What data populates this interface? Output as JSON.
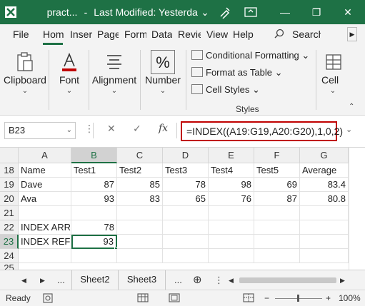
{
  "titlebar": {
    "filename": "pract...",
    "separator": "-",
    "modified": "Last Modified: Yesterda",
    "chevron": "⌄",
    "minimize": "—",
    "restore": "❐",
    "close": "✕"
  },
  "tabs": [
    "File",
    "Hom",
    "Inser",
    "Page",
    "Form",
    "Data",
    "Revie",
    "View",
    "Help"
  ],
  "search_label": "Search",
  "ribbon": {
    "clipboard": "Clipboard",
    "font": "Font",
    "alignment": "Alignment",
    "number": "Number",
    "conditional_formatting": "Conditional Formatting",
    "format_as_table": "Format as Table",
    "cell_styles": "Cell Styles",
    "styles_caption": "Styles",
    "cells": "Cell",
    "chevron": "⌄"
  },
  "formula_bar": {
    "name_box": "B23",
    "fx": "fx",
    "cancel": "✕",
    "enter": "✓",
    "formula": "=INDEX((A19:G19,A20:G20),1,0,2)"
  },
  "grid": {
    "columns": [
      "A",
      "B",
      "C",
      "D",
      "E",
      "F",
      "G"
    ],
    "rows": [
      {
        "num": "18",
        "cells": [
          "Name",
          "Test1",
          "Test2",
          "Test3",
          "Test4",
          "Test5",
          "Average"
        ]
      },
      {
        "num": "19",
        "cells": [
          "Dave",
          "87",
          "85",
          "78",
          "98",
          "69",
          "83.4"
        ]
      },
      {
        "num": "20",
        "cells": [
          "Ava",
          "93",
          "83",
          "65",
          "76",
          "87",
          "80.8"
        ]
      },
      {
        "num": "21",
        "cells": [
          "",
          "",
          "",
          "",
          "",
          "",
          ""
        ]
      },
      {
        "num": "22",
        "cells": [
          "INDEX ARRA",
          "78",
          "",
          "",
          "",
          "",
          ""
        ]
      },
      {
        "num": "23",
        "cells": [
          "INDEX REFE",
          "93",
          "",
          "",
          "",
          "",
          ""
        ]
      },
      {
        "num": "24",
        "cells": [
          "",
          "",
          "",
          "",
          "",
          "",
          ""
        ]
      },
      {
        "num": "25",
        "cells": [
          "",
          "",
          "",
          "",
          "",
          "",
          ""
        ]
      }
    ],
    "active_cell": "B23"
  },
  "sheets": {
    "prev": "◀",
    "next": "▶",
    "ellipsis": "...",
    "tabs": [
      "Sheet2",
      "Sheet3"
    ],
    "add": "⊕"
  },
  "status": {
    "ready": "Ready",
    "zoom": "100%",
    "minus": "−",
    "plus": "+"
  }
}
